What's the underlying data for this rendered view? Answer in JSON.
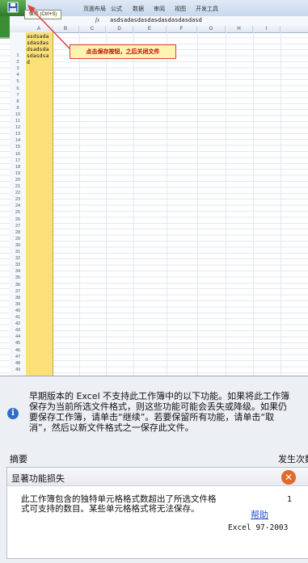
{
  "ribbon": {
    "tabs": [
      "页面布局",
      "公式",
      "数据",
      "审阅",
      "视图",
      "开发工具"
    ],
    "save_tooltip": "保存 (Ctrl+S)"
  },
  "formula_bar": {
    "fx": "fx",
    "value": "asdsadasdasdasdasdasdasdasd"
  },
  "columns": [
    "A",
    "B",
    "C",
    "D",
    "E",
    "F",
    "G",
    "H",
    "I"
  ],
  "rows": [
    "1",
    "2",
    "3",
    "4",
    "5",
    "6",
    "7",
    "8",
    "9",
    "10",
    "11",
    "12",
    "13",
    "14",
    "15",
    "16",
    "17",
    "18",
    "19",
    "20",
    "21",
    "22",
    "23",
    "24",
    "25",
    "26",
    "27",
    "28",
    "29",
    "30",
    "31",
    "32",
    "33",
    "34",
    "35",
    "36",
    "37",
    "38",
    "39",
    "40",
    "41",
    "42",
    "43",
    "44",
    "45",
    "46",
    "47",
    "48",
    "49"
  ],
  "cell_a1": "asdsadasdasdasdsadsdasdasdsad",
  "callout": "点击保存按钮，之后关闭文件",
  "dialog": {
    "message_lines": [
      "早期版本的 Excel 不支持此工作簿中的以下功能。如果将此工作簿",
      "保存为当前所选文件格式，则这些功能可能会丢失或降级。如果仍",
      "要保存工作簿，请单击“继续”。若要保留所有功能，请单击“取",
      "消”，然后以新文件格式之一保存此文件。"
    ],
    "summary_label": "摘要",
    "occurrence_label": "发生次数",
    "issue_title": "显著功能损失",
    "issue_description": "此工作簿包含的独特单元格格式数超出了所选文件格式可支持的数目。某些单元格格式将无法保存。",
    "count": "1",
    "help": "帮助",
    "version": "Excel 97-2003"
  },
  "colors": {
    "selected_column": "#fbe07a",
    "callout_border": "#e04040",
    "link": "#1c56c9",
    "error_icon": "#e06a2a"
  },
  "icons": [
    "save-icon",
    "info-icon",
    "close-circle-icon"
  ]
}
